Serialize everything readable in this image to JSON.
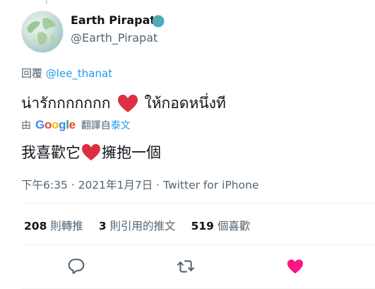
{
  "author": {
    "display_name": "Earth Pirapat",
    "handle": "@Earth_Pirapat",
    "avatar_icon": "globe-map-avatar",
    "badge_icon": "globe-emoji-icon"
  },
  "reply": {
    "prefix": "回覆",
    "mention": "@lee_thanat"
  },
  "tweet": {
    "text_before": "น่ารักกกกกกก",
    "text_after": "ให้กอดหนึ่งที",
    "emoji": "red-heart-emoji"
  },
  "translation_bar": {
    "by": "由",
    "google": [
      "G",
      "o",
      "o",
      "g",
      "l",
      "e"
    ],
    "translated_from": "翻譯自",
    "language": "泰文"
  },
  "translation": {
    "text_before": "我喜歡它",
    "text_after": "擁抱一個"
  },
  "meta": {
    "text": "下午6:35 · 2021年1月7日 · Twitter for iPhone"
  },
  "stats": {
    "retweets": {
      "count": "208",
      "label": "則轉推"
    },
    "quotes": {
      "count": "3",
      "label": "則引用的推文"
    },
    "likes": {
      "count": "519",
      "label": "個喜歡"
    }
  },
  "colors": {
    "accent": "#1d9bf0",
    "like_active": "#f91880",
    "muted": "#536471"
  }
}
